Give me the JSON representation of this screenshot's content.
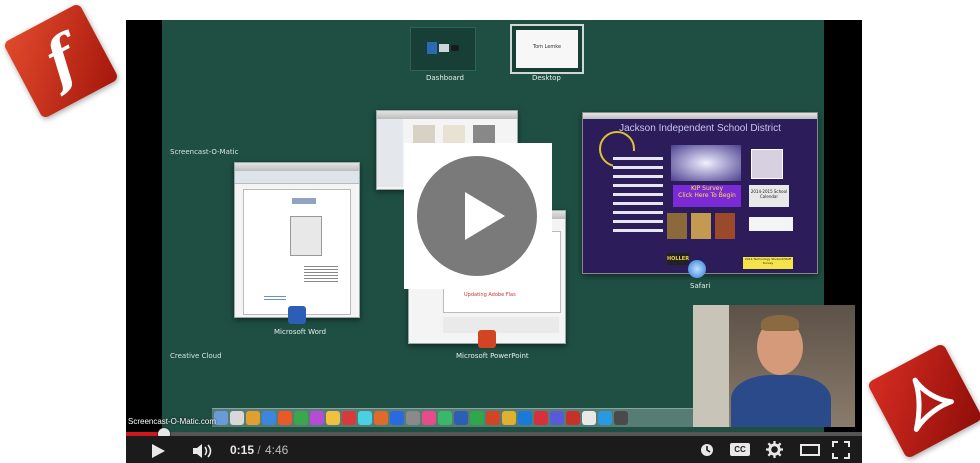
{
  "spaces": {
    "dashboard_label": "Dashboard",
    "desktop_label": "Desktop",
    "desktop_note": "Tom Lemke"
  },
  "groups": {
    "screencast": "Screencast-O-Matic",
    "creative_cloud": "Creative Cloud"
  },
  "windows": {
    "word_label": "Microsoft Word",
    "powerpoint_label": "Microsoft PowerPoint",
    "powerpoint_slide_text": "Updating Adobe Flas",
    "safari_label": "Safari",
    "safari_page_title": "Jackson Independent School District",
    "survey_text_1": "KIP Survey",
    "survey_text_2": "Click Here To Begin",
    "calendar_text": "2014-2015 School Calendar",
    "holler_text": "HOLLER",
    "technology_text": "2014 Technology Student/Staff Survey"
  },
  "video": {
    "caption_overlay": "Screencast-O-Matic.com",
    "current_time": "0:15",
    "separator": " / ",
    "duration": "4:46",
    "progress_percent": 5.2
  },
  "colors": {
    "stage_bg": "#1f4f43",
    "progress_red": "#cc181e",
    "flash_red": "#c72f1a",
    "pdf_red": "#b81d16"
  },
  "icons": {
    "flash_badge_glyph": "f",
    "play": "play-icon",
    "volume": "volume-icon",
    "watch_later": "watch-later-icon",
    "cc": "CC",
    "settings": "gear-icon",
    "theater": "theater-icon",
    "fullscreen": "fullscreen-icon"
  }
}
